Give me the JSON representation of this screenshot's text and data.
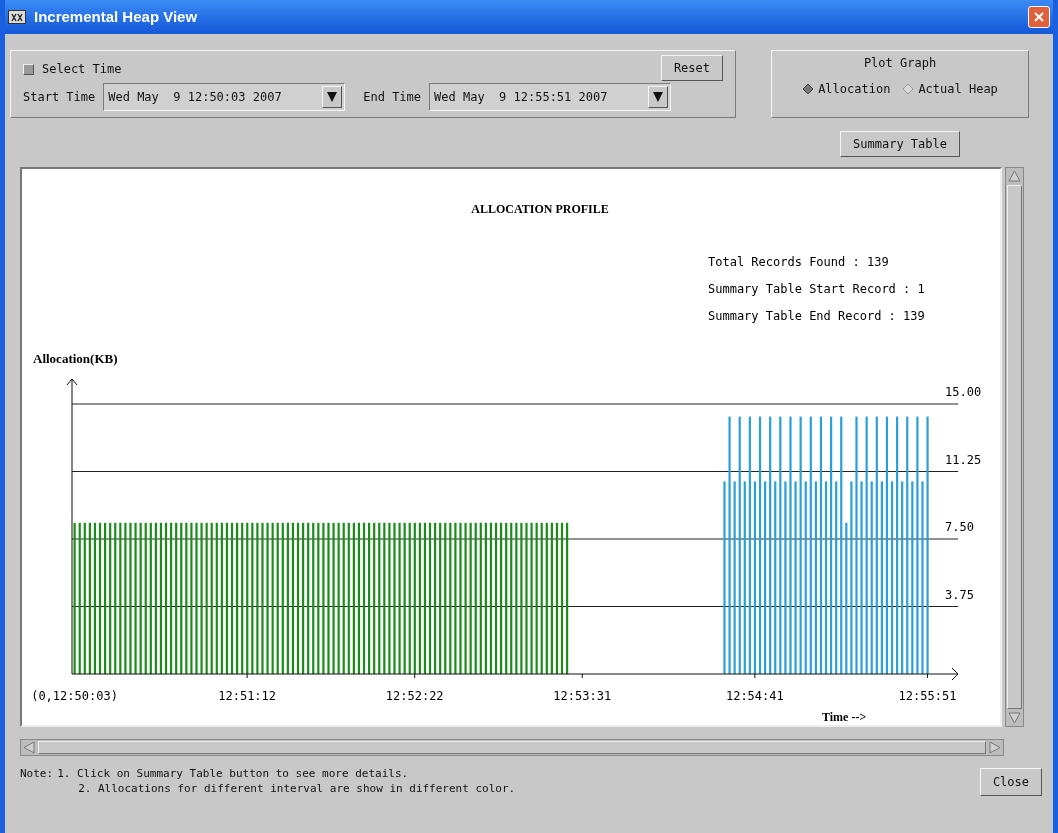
{
  "window": {
    "title": "Incremental Heap View"
  },
  "select_time": {
    "label": "Select Time",
    "checked": false
  },
  "reset_button": "Reset",
  "start_time": {
    "label": "Start Time",
    "value": "Wed May  9 12:50:03 2007"
  },
  "end_time": {
    "label": "End Time",
    "value": "Wed May  9 12:55:51 2007"
  },
  "plot_graph": {
    "title": "Plot Graph",
    "options": [
      {
        "label": "Allocation",
        "selected": true
      },
      {
        "label": "Actual Heap",
        "selected": false
      }
    ]
  },
  "summary_button": "Summary Table",
  "chart": {
    "stats": [
      "Total Records Found : 139",
      "Summary Table Start Record : 1",
      "Summary Table End Record : 139"
    ],
    "chart_data": {
      "type": "bar",
      "grid": true,
      "title": "ALLOCATION PROFILE",
      "xlabel": "Time -->",
      "ylabel": "Allocation(KB)",
      "ylim": [
        0,
        15
      ],
      "yticks": [
        {
          "value": 3.75,
          "label": "3.75"
        },
        {
          "value": 7.5,
          "label": "7.50"
        },
        {
          "value": 11.25,
          "label": "11.25"
        },
        {
          "value": 15,
          "label": "15.00"
        }
      ],
      "categories": [
        "(0,12:50:03)",
        null,
        null,
        null,
        null,
        null,
        null,
        null,
        null,
        null,
        null,
        null,
        null,
        null,
        null,
        null,
        null,
        null,
        null,
        null,
        null,
        null,
        null,
        null,
        null,
        null,
        null,
        null,
        null,
        null,
        null,
        null,
        null,
        null,
        "12:51:12",
        null,
        null,
        null,
        null,
        null,
        null,
        null,
        null,
        null,
        null,
        null,
        null,
        null,
        null,
        null,
        null,
        null,
        null,
        null,
        null,
        null,
        null,
        null,
        null,
        null,
        null,
        null,
        null,
        null,
        null,
        null,
        null,
        "12:52:22",
        null,
        null,
        null,
        null,
        null,
        null,
        null,
        null,
        null,
        null,
        null,
        null,
        null,
        null,
        null,
        null,
        null,
        null,
        null,
        null,
        null,
        null,
        null,
        null,
        null,
        null,
        null,
        null,
        null,
        null,
        null,
        null,
        "12:53:31",
        null,
        null,
        null,
        null,
        null,
        null,
        null,
        null,
        null,
        null,
        null,
        null,
        null,
        null,
        null,
        null,
        null,
        null,
        null,
        null,
        null,
        null,
        null,
        null,
        null,
        null,
        null,
        null,
        null,
        null,
        null,
        null,
        null,
        "12:54:41",
        null,
        null,
        null,
        null,
        null,
        null,
        null,
        null,
        null,
        null,
        null,
        null,
        null,
        null,
        null,
        null,
        null,
        null,
        null,
        null,
        null,
        null,
        null,
        null,
        null,
        null,
        null,
        null,
        null,
        null,
        null,
        null,
        null,
        "12:55:51"
      ],
      "series": [
        {
          "color": "#1a8c1a",
          "values": [
            8.4,
            8.4,
            8.4,
            8.4,
            8.4,
            8.4,
            8.4,
            8.4,
            8.4,
            8.4,
            8.4,
            8.4,
            8.4,
            8.4,
            8.4,
            8.4,
            8.4,
            8.4,
            8.4,
            8.4,
            8.4,
            8.4,
            8.4,
            8.4,
            8.4,
            8.4,
            8.4,
            8.4,
            8.4,
            8.4,
            8.4,
            8.4,
            8.4,
            8.4,
            8.4,
            8.4,
            8.4,
            8.4,
            8.4,
            8.4,
            8.4,
            8.4,
            8.4,
            8.4,
            8.4,
            8.4,
            8.4,
            8.4,
            8.4,
            8.4,
            8.4,
            8.4,
            8.4,
            8.4,
            8.4,
            8.4,
            8.4,
            8.4,
            8.4,
            8.4,
            8.4,
            8.4,
            8.4,
            8.4,
            8.4,
            8.4,
            8.4,
            8.4,
            8.4,
            8.4,
            8.4,
            8.4,
            8.4,
            8.4,
            8.4,
            8.4,
            8.4,
            8.4,
            8.4,
            8.4,
            8.4,
            8.4,
            8.4,
            8.4,
            8.4,
            8.4,
            8.4,
            8.4,
            8.4,
            8.4,
            8.4,
            8.4,
            8.4,
            8.4,
            8.4,
            8.4,
            8.4,
            8.4,
            null,
            null,
            null,
            null,
            null,
            null,
            null,
            null,
            null,
            null,
            null,
            null,
            null,
            null,
            null,
            null,
            null,
            null,
            null,
            null,
            null,
            null,
            null,
            null,
            null,
            null,
            null,
            null,
            null,
            null,
            null,
            null,
            null,
            null,
            null,
            null,
            null,
            null,
            null,
            null,
            null,
            null,
            null,
            null,
            null,
            null,
            null,
            null,
            null,
            null,
            null,
            null,
            null,
            null,
            null,
            null,
            null,
            null,
            null,
            null,
            null,
            null,
            null,
            null,
            null,
            null,
            null,
            null,
            null,
            null,
            null
          ]
        },
        {
          "color": "#2a9fd8",
          "values": [
            null,
            null,
            null,
            null,
            null,
            null,
            null,
            null,
            null,
            null,
            null,
            null,
            null,
            null,
            null,
            null,
            null,
            null,
            null,
            null,
            null,
            null,
            null,
            null,
            null,
            null,
            null,
            null,
            null,
            null,
            null,
            null,
            null,
            null,
            null,
            null,
            null,
            null,
            null,
            null,
            null,
            null,
            null,
            null,
            null,
            null,
            null,
            null,
            null,
            null,
            null,
            null,
            null,
            null,
            null,
            null,
            null,
            null,
            null,
            null,
            null,
            null,
            null,
            null,
            null,
            null,
            null,
            null,
            null,
            null,
            null,
            null,
            null,
            null,
            null,
            null,
            null,
            null,
            null,
            null,
            null,
            null,
            null,
            null,
            null,
            null,
            null,
            null,
            null,
            null,
            null,
            null,
            null,
            null,
            null,
            null,
            null,
            null,
            null,
            null,
            null,
            null,
            null,
            null,
            null,
            null,
            null,
            null,
            null,
            null,
            null,
            null,
            null,
            null,
            null,
            null,
            null,
            null,
            null,
            null,
            null,
            null,
            null,
            null,
            null,
            null,
            null,
            null,
            10.7,
            14.3,
            10.7,
            14.3,
            10.7,
            14.3,
            10.7,
            14.3,
            10.7,
            14.3,
            10.7,
            14.3,
            10.7,
            14.3,
            10.7,
            14.3,
            10.7,
            14.3,
            10.7,
            14.3,
            10.7,
            14.3,
            10.7,
            14.3,
            8.4,
            10.7,
            14.3,
            10.7,
            14.3,
            10.7,
            14.3,
            10.7,
            14.3,
            10.7,
            14.3,
            10.7,
            14.3,
            10.7,
            14.3,
            10.7,
            14.3
          ]
        }
      ]
    }
  },
  "notes": {
    "prefix": "Note:",
    "lines": [
      "1. Click on Summary Table button to see more details.",
      "2. Allocations for different interval are show in different color."
    ]
  },
  "close_button": "Close"
}
